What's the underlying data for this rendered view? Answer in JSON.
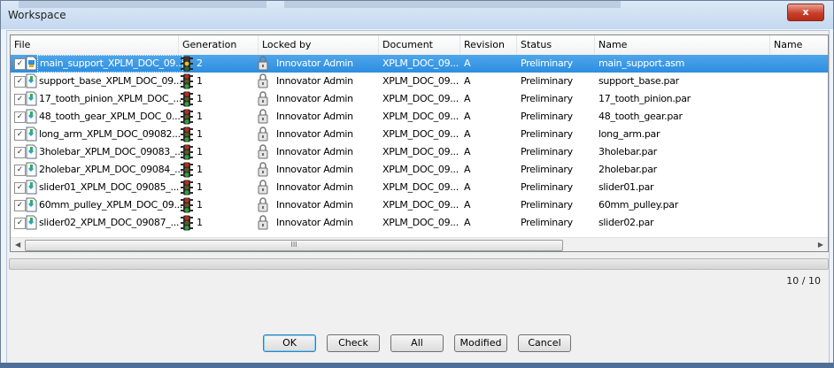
{
  "window": {
    "title": "Workspace",
    "close_glyph": "x"
  },
  "grid": {
    "columns": [
      "File",
      "Generation",
      "Locked by",
      "Document",
      "Revision",
      "Status",
      "Name",
      "Name"
    ],
    "rows": [
      {
        "checked": true,
        "file": "main_support_XPLM_DOC_09...",
        "generation": "2",
        "locked_by": "Innovator Admin",
        "document": "XPLM_DOC_09...",
        "revision": "A",
        "status": "Preliminary",
        "name": "main_support.asm",
        "name2": "",
        "selected": true,
        "icon": "assembly-file-icon",
        "status_icon": "traffic-light-icon",
        "light": "yellow"
      },
      {
        "checked": true,
        "file": "support_base_XPLM_DOC_09...",
        "generation": "1",
        "locked_by": "Innovator Admin",
        "document": "XPLM_DOC_09...",
        "revision": "A",
        "status": "Preliminary",
        "name": "support_base.par",
        "name2": "",
        "selected": false,
        "icon": "part-file-icon",
        "status_icon": "traffic-light-icon",
        "light": "red"
      },
      {
        "checked": true,
        "file": "17_tooth_pinion_XPLM_DOC_...",
        "generation": "1",
        "locked_by": "Innovator Admin",
        "document": "XPLM_DOC_09...",
        "revision": "A",
        "status": "Preliminary",
        "name": "17_tooth_pinion.par",
        "name2": "",
        "selected": false,
        "icon": "part-file-icon",
        "status_icon": "traffic-light-icon",
        "light": "red"
      },
      {
        "checked": true,
        "file": "48_tooth_gear_XPLM_DOC_0...",
        "generation": "1",
        "locked_by": "Innovator Admin",
        "document": "XPLM_DOC_09...",
        "revision": "A",
        "status": "Preliminary",
        "name": "48_tooth_gear.par",
        "name2": "",
        "selected": false,
        "icon": "part-file-icon",
        "status_icon": "traffic-light-icon",
        "light": "red"
      },
      {
        "checked": true,
        "file": "long_arm_XPLM_DOC_09082...",
        "generation": "1",
        "locked_by": "Innovator Admin",
        "document": "XPLM_DOC_09...",
        "revision": "A",
        "status": "Preliminary",
        "name": "long_arm.par",
        "name2": "",
        "selected": false,
        "icon": "part-file-icon",
        "status_icon": "traffic-light-icon",
        "light": "red"
      },
      {
        "checked": true,
        "file": "3holebar_XPLM_DOC_09083_...",
        "generation": "1",
        "locked_by": "Innovator Admin",
        "document": "XPLM_DOC_09...",
        "revision": "A",
        "status": "Preliminary",
        "name": "3holebar.par",
        "name2": "",
        "selected": false,
        "icon": "part-file-icon",
        "status_icon": "traffic-light-icon",
        "light": "red"
      },
      {
        "checked": true,
        "file": "2holebar_XPLM_DOC_09084_...",
        "generation": "1",
        "locked_by": "Innovator Admin",
        "document": "XPLM_DOC_09...",
        "revision": "A",
        "status": "Preliminary",
        "name": "2holebar.par",
        "name2": "",
        "selected": false,
        "icon": "part-file-icon",
        "status_icon": "traffic-light-icon",
        "light": "red"
      },
      {
        "checked": true,
        "file": "slider01_XPLM_DOC_09085_...",
        "generation": "1",
        "locked_by": "Innovator Admin",
        "document": "XPLM_DOC_09...",
        "revision": "A",
        "status": "Preliminary",
        "name": "slider01.par",
        "name2": "",
        "selected": false,
        "icon": "part-file-icon",
        "status_icon": "traffic-light-icon",
        "light": "red"
      },
      {
        "checked": true,
        "file": "60mm_pulley_XPLM_DOC_09...",
        "generation": "1",
        "locked_by": "Innovator Admin",
        "document": "XPLM_DOC_09...",
        "revision": "A",
        "status": "Preliminary",
        "name": "60mm_pulley.par",
        "name2": "",
        "selected": false,
        "icon": "part-file-icon",
        "status_icon": "traffic-light-icon",
        "light": "red"
      },
      {
        "checked": true,
        "file": "slider02_XPLM_DOC_09087_...",
        "generation": "1",
        "locked_by": "Innovator Admin",
        "document": "XPLM_DOC_09...",
        "revision": "A",
        "status": "Preliminary",
        "name": "slider02.par",
        "name2": "",
        "selected": false,
        "icon": "part-file-icon",
        "status_icon": "traffic-light-icon",
        "light": "red"
      }
    ],
    "scroll_grip": "III"
  },
  "counter": "10 / 10",
  "buttons": {
    "ok": "OK",
    "check": "Check",
    "all": "All",
    "modified": "Modified",
    "cancel": "Cancel"
  },
  "colors": {
    "selection": "#3399ff",
    "light_red": "#c8281e",
    "light_green": "#2fa33a",
    "light_yellow": "#e7c21c"
  }
}
